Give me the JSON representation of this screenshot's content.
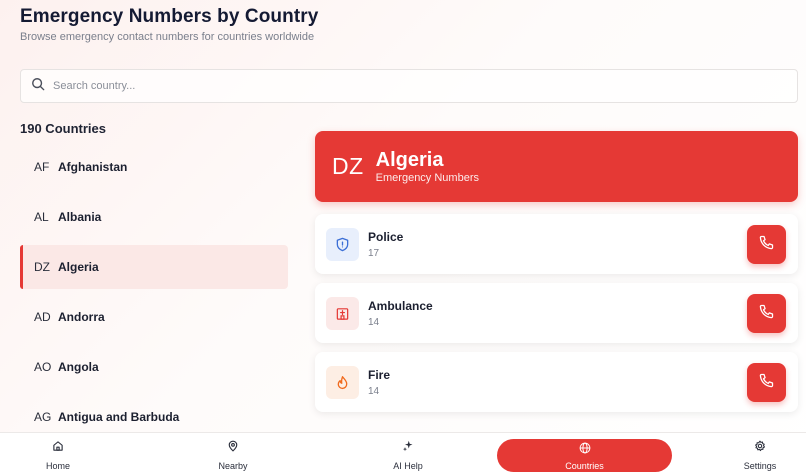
{
  "header": {
    "title": "Emergency Numbers by Country",
    "subtitle": "Browse emergency contact numbers for countries worldwide"
  },
  "search": {
    "placeholder": "Search country...",
    "value": "",
    "icon": "search-icon"
  },
  "country_count": "190 Countries",
  "countries": [
    {
      "code": "AF",
      "name": "Afghanistan",
      "active": false
    },
    {
      "code": "AL",
      "name": "Albania",
      "active": false
    },
    {
      "code": "DZ",
      "name": "Algeria",
      "active": true
    },
    {
      "code": "AD",
      "name": "Andorra",
      "active": false
    },
    {
      "code": "AO",
      "name": "Angola",
      "active": false
    },
    {
      "code": "AG",
      "name": "Antigua and Barbuda",
      "active": false
    }
  ],
  "selected": {
    "code": "DZ",
    "name": "Algeria",
    "subtitle": "Emergency Numbers"
  },
  "services": [
    {
      "name": "Police",
      "number": "17",
      "icon": "shield-icon",
      "icon_bg": "#e8effc",
      "icon_color": "#3b6fd6"
    },
    {
      "name": "Ambulance",
      "number": "14",
      "icon": "ambulance-icon",
      "icon_bg": "#fbe9e8",
      "icon_color": "#e53935"
    },
    {
      "name": "Fire",
      "number": "14",
      "icon": "fire-icon",
      "icon_bg": "#fdeee4",
      "icon_color": "#f06a1d"
    }
  ],
  "nav": [
    {
      "label": "Home",
      "icon": "home-icon",
      "active": false
    },
    {
      "label": "Nearby",
      "icon": "location-pin-icon",
      "active": false
    },
    {
      "label": "AI Help",
      "icon": "sparkles-icon",
      "active": false
    },
    {
      "label": "Countries",
      "icon": "globe-icon",
      "active": true
    },
    {
      "label": "Settings",
      "icon": "gear-icon",
      "active": false
    }
  ],
  "colors": {
    "accent": "#e53935",
    "active_row_bg": "#fbe8e6"
  }
}
